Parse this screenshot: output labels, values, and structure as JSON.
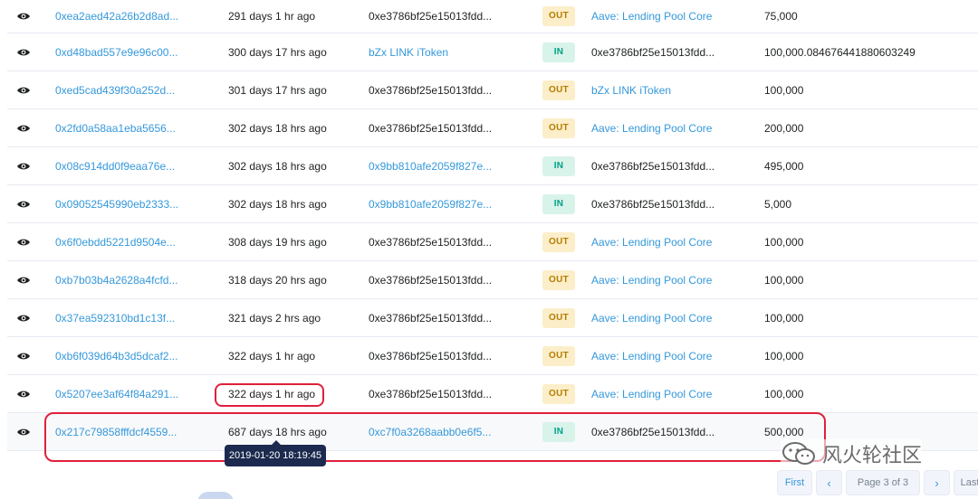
{
  "table": {
    "rows": [
      {
        "hash": "0xea2aed42a26b2d8ad...",
        "age": "291 days 1 hr ago",
        "from": "0xe3786bf25e15013fdd...",
        "from_link": false,
        "direction": "OUT",
        "to": "Aave: Lending Pool Core",
        "to_link": true,
        "quantity": "75,000"
      },
      {
        "hash": "0xd48bad557e9e96c00...",
        "age": "300 days 17 hrs ago",
        "from": "bZx LINK iToken",
        "from_link": true,
        "direction": "IN",
        "to": "0xe3786bf25e15013fdd...",
        "to_link": false,
        "quantity": "100,000.084676441880603249"
      },
      {
        "hash": "0xed5cad439f30a252d...",
        "age": "301 days 17 hrs ago",
        "from": "0xe3786bf25e15013fdd...",
        "from_link": false,
        "direction": "OUT",
        "to": "bZx LINK iToken",
        "to_link": true,
        "quantity": "100,000"
      },
      {
        "hash": "0x2fd0a58aa1eba5656...",
        "age": "302 days 18 hrs ago",
        "from": "0xe3786bf25e15013fdd...",
        "from_link": false,
        "direction": "OUT",
        "to": "Aave: Lending Pool Core",
        "to_link": true,
        "quantity": "200,000"
      },
      {
        "hash": "0x08c914dd0f9eaa76e...",
        "age": "302 days 18 hrs ago",
        "from": "0x9bb810afe2059f827e...",
        "from_link": true,
        "direction": "IN",
        "to": "0xe3786bf25e15013fdd...",
        "to_link": false,
        "quantity": "495,000"
      },
      {
        "hash": "0x09052545990eb2333...",
        "age": "302 days 18 hrs ago",
        "from": "0x9bb810afe2059f827e...",
        "from_link": true,
        "direction": "IN",
        "to": "0xe3786bf25e15013fdd...",
        "to_link": false,
        "quantity": "5,000"
      },
      {
        "hash": "0x6f0ebdd5221d9504e...",
        "age": "308 days 19 hrs ago",
        "from": "0xe3786bf25e15013fdd...",
        "from_link": false,
        "direction": "OUT",
        "to": "Aave: Lending Pool Core",
        "to_link": true,
        "quantity": "100,000"
      },
      {
        "hash": "0xb7b03b4a2628a4fcfd...",
        "age": "318 days 20 hrs ago",
        "from": "0xe3786bf25e15013fdd...",
        "from_link": false,
        "direction": "OUT",
        "to": "Aave: Lending Pool Core",
        "to_link": true,
        "quantity": "100,000"
      },
      {
        "hash": "0x37ea592310bd1c13f...",
        "age": "321 days 2 hrs ago",
        "from": "0xe3786bf25e15013fdd...",
        "from_link": false,
        "direction": "OUT",
        "to": "Aave: Lending Pool Core",
        "to_link": true,
        "quantity": "100,000"
      },
      {
        "hash": "0xb6f039d64b3d5dcaf2...",
        "age": "322 days 1 hr ago",
        "from": "0xe3786bf25e15013fdd...",
        "from_link": false,
        "direction": "OUT",
        "to": "Aave: Lending Pool Core",
        "to_link": true,
        "quantity": "100,000"
      },
      {
        "hash": "0x5207ee3af64f84a291...",
        "age": "322 days 1 hr ago",
        "from": "0xe3786bf25e15013fdd...",
        "from_link": false,
        "direction": "OUT",
        "to": "Aave: Lending Pool Core",
        "to_link": true,
        "quantity": "100,000"
      },
      {
        "hash": "0x217c79858fffdcf4559...",
        "age": "687 days 18 hrs ago",
        "from": "0xc7f0a3268aabb0e6f5...",
        "from_link": true,
        "direction": "IN",
        "to": "0xe3786bf25e15013fdd...",
        "to_link": false,
        "quantity": "500,000"
      }
    ]
  },
  "tooltip": {
    "text": "2019-01-20 18:19:45"
  },
  "pagination": {
    "first": "First",
    "prev": "‹",
    "page": "Page 3 of 3",
    "next": "›",
    "last": "Last"
  },
  "watermark": {
    "text": "风火轮社区"
  },
  "colors": {
    "link": "#3498db",
    "annotation": "#e0203a",
    "out_badge": "#fbeec9",
    "in_badge": "#d8f3ea"
  }
}
